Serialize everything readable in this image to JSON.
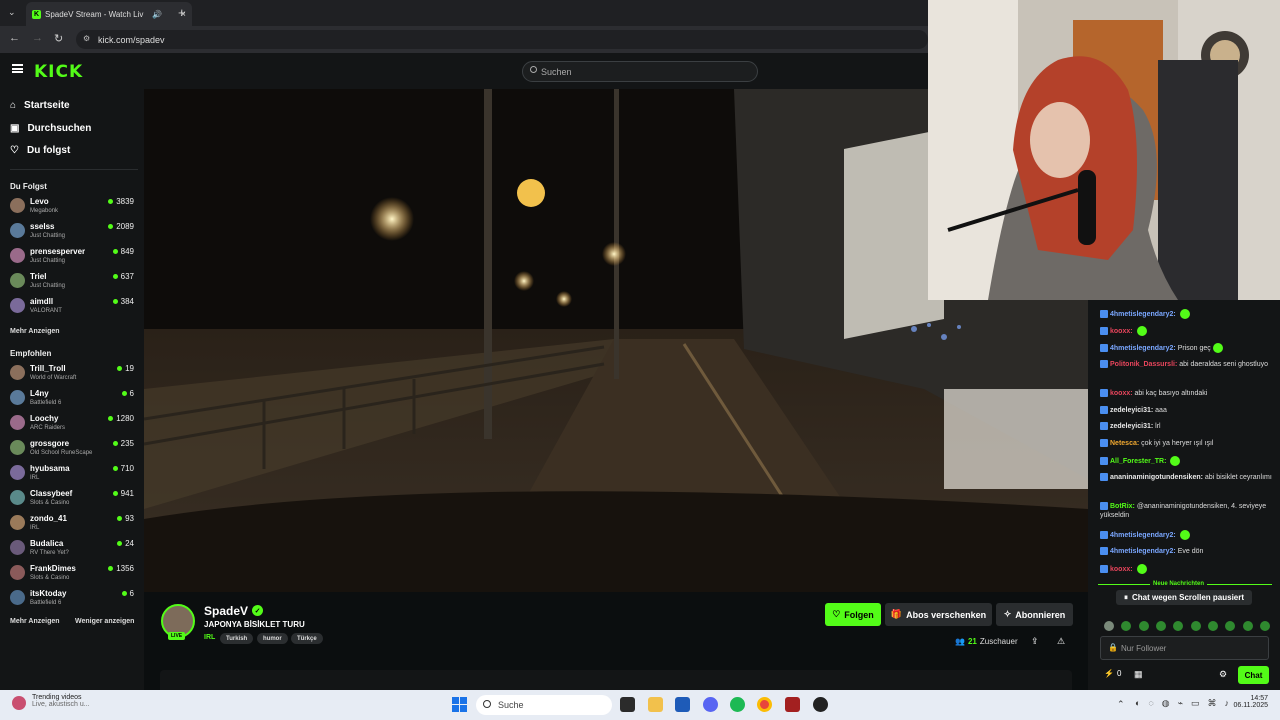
{
  "browser": {
    "tab_title": "SpadeV Stream - Watch Liv",
    "url": "kick.com/spadev"
  },
  "header": {
    "logo": "KICK",
    "search_placeholder": "Suchen"
  },
  "sidebar": {
    "nav": [
      {
        "label": "Startseite"
      },
      {
        "label": "Durchsuchen"
      },
      {
        "label": "Du folgst"
      }
    ],
    "following_title": "Du Folgst",
    "following": [
      {
        "name": "Levo",
        "category": "Megabonk",
        "viewers": "3839"
      },
      {
        "name": "sselss",
        "category": "Just Chatting",
        "viewers": "2089"
      },
      {
        "name": "prensesperver",
        "category": "Just Chatting",
        "viewers": "849"
      },
      {
        "name": "Triel",
        "category": "Just Chatting",
        "viewers": "637"
      },
      {
        "name": "aimdll",
        "category": "VALORANT",
        "viewers": "384"
      }
    ],
    "show_more": "Mehr Anzeigen",
    "recommended_title": "Empfohlen",
    "recommended": [
      {
        "name": "Trill_Troll",
        "category": "World of Warcraft",
        "viewers": "19"
      },
      {
        "name": "L4ny",
        "category": "Battlefield 6",
        "viewers": "6"
      },
      {
        "name": "Loochy",
        "category": "ARC Raiders",
        "viewers": "1280"
      },
      {
        "name": "grossgore",
        "category": "Old School RuneScape",
        "viewers": "235"
      },
      {
        "name": "hyubsama",
        "category": "IRL",
        "viewers": "710"
      },
      {
        "name": "Classybeef",
        "category": "Slots & Casino",
        "viewers": "941"
      },
      {
        "name": "zondo_41",
        "category": "IRL",
        "viewers": "93"
      },
      {
        "name": "Budalica",
        "category": "RV There Yet?",
        "viewers": "24"
      },
      {
        "name": "FrankDimes",
        "category": "Slots & Casino",
        "viewers": "1356"
      },
      {
        "name": "itsKtoday",
        "category": "Battlefield 6",
        "viewers": "6"
      }
    ],
    "show_more2": "Mehr Anzeigen",
    "show_less": "Weniger anzeigen"
  },
  "stream": {
    "channel": "SpadeV",
    "title": "JAPONYA BİSİKLET TURU",
    "category": "IRL",
    "tags": [
      "Turkish",
      "humor",
      "Türkçe"
    ],
    "live": "LIVE",
    "viewers": "21",
    "viewers_label": "Zuschauer",
    "follow": "Folgen",
    "gift": "Abos verschenken",
    "subscribe": "Abonnieren"
  },
  "chat": {
    "messages": [
      {
        "user": "4hmetislegendary2:",
        "text": "",
        "color": "#7aa7ff",
        "emote": true
      },
      {
        "user": "kooxx:",
        "text": "",
        "color": "#e8455c",
        "emote": true
      },
      {
        "user": "4hmetislegendary2:",
        "text": "Prison geç",
        "color": "#7aa7ff",
        "emote": true
      },
      {
        "user": "Politonik_Dassursli:",
        "text": "abi daeraldas seni ghostluyo",
        "color": "#e8455c",
        "emote": false
      },
      {
        "user": "kooxx:",
        "text": "abi kaç basıyo altındaki",
        "color": "#e8455c",
        "emote": false
      },
      {
        "user": "zedeleyici31:",
        "text": "aaa",
        "color": "#e8e8e8",
        "emote": false
      },
      {
        "user": "zedeleyici31:",
        "text": "lrl",
        "color": "#e8e8e8",
        "emote": false
      },
      {
        "user": "Netesca:",
        "text": "çok iyi ya heryer ışıl ışıl",
        "color": "#f0a830",
        "emote": false
      },
      {
        "user": "All_Forester_TR:",
        "text": "",
        "color": "#53fc18",
        "emote": true
      },
      {
        "user": "ananinaminigotundensiken:",
        "text": "abi bisiklet ceyranlımı",
        "color": "#e8e8e8",
        "emote": false
      },
      {
        "user": "BotRix:",
        "text": "@ananinaminigotundensiken, 4. seviyeye yükseldin",
        "color": "#53fc18",
        "emote": false
      },
      {
        "user": "4hmetislegendary2:",
        "text": "",
        "color": "#7aa7ff",
        "emote": true
      },
      {
        "user": "4hmetislegendary2:",
        "text": "Eve dön",
        "color": "#7aa7ff",
        "emote": false
      },
      {
        "user": "kooxx:",
        "text": "",
        "color": "#e8455c",
        "emote": true
      }
    ],
    "new_messages": "Neue Nachrichten",
    "paused": "Chat wegen Scrollen pausiert",
    "input_placeholder": "Nur Follower",
    "points": "0",
    "send": "Chat"
  },
  "taskbar": {
    "trending_title": "Trending videos",
    "trending_sub": "Live, akustisch u...",
    "search": "Suche",
    "time": "14:57",
    "date": "06.11.2025"
  },
  "colors": {
    "accent": "#53fc18",
    "bg": "#0b0e0f",
    "panel": "#131516"
  }
}
